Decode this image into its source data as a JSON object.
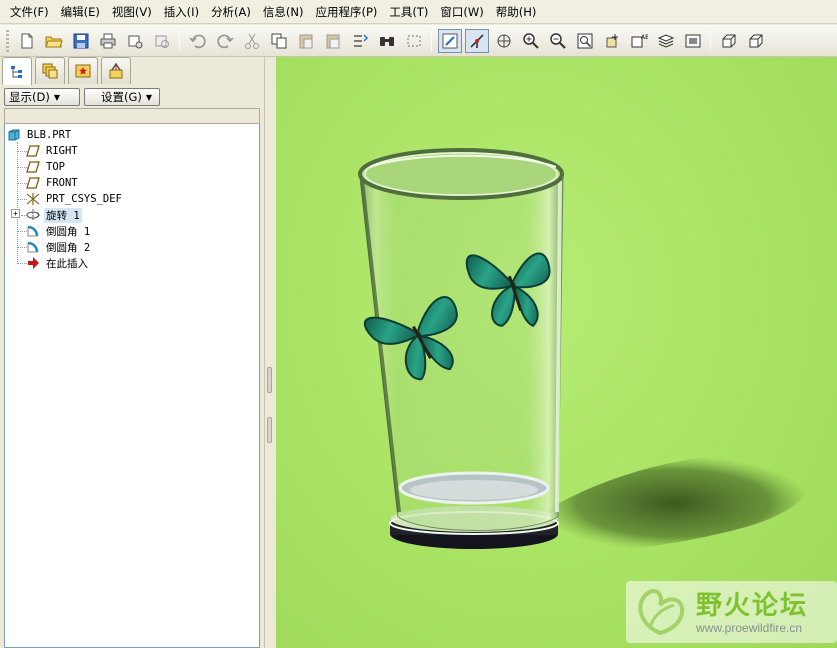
{
  "menubar": {
    "items": [
      "文件(F)",
      "编辑(E)",
      "视图(V)",
      "插入(I)",
      "分析(A)",
      "信息(N)",
      "应用程序(P)",
      "工具(T)",
      "窗口(W)",
      "帮助(H)"
    ]
  },
  "toolbar": {
    "icons": [
      "new-file-icon",
      "open-folder-icon",
      "save-icon",
      "print-icon",
      "erase-icon",
      "regenerate-icon",
      "undo-icon",
      "redo-icon",
      "cut-icon",
      "copy-icon",
      "paste-icon",
      "paste-special-icon",
      "regenerate-manager-icon",
      "find-icon",
      "select-box-icon",
      "repaint-icon",
      "spin-center-icon",
      "orient-mode-icon",
      "zoom-in-icon",
      "zoom-out-icon",
      "refit-icon",
      "reorient-icon",
      "saved-views-icon",
      "layers-icon",
      "view-manager-icon",
      "shading-icon",
      "no-hidden-icon"
    ]
  },
  "panel": {
    "show_button": "显示(D)",
    "settings_button": "设置(G)"
  },
  "tree": {
    "root": "BLB.PRT",
    "items": [
      {
        "label": "RIGHT",
        "icon": "datum-plane-icon"
      },
      {
        "label": "TOP",
        "icon": "datum-plane-icon"
      },
      {
        "label": "FRONT",
        "icon": "datum-plane-icon"
      },
      {
        "label": "PRT_CSYS_DEF",
        "icon": "coordinate-system-icon"
      },
      {
        "label": "旋转 1",
        "icon": "revolve-icon"
      },
      {
        "label": "倒圆角 1",
        "icon": "round-icon"
      },
      {
        "label": "倒圆角 2",
        "icon": "round-icon"
      },
      {
        "label": "在此插入",
        "icon": "insert-here-icon"
      }
    ]
  },
  "watermark": {
    "title": "野火论坛",
    "url": "www.proewildfire.cn"
  },
  "colors": {
    "viewport_bg": "#a8e262",
    "selection_highlight": "#d6e6f5",
    "watermark_green": "#7fc230"
  }
}
